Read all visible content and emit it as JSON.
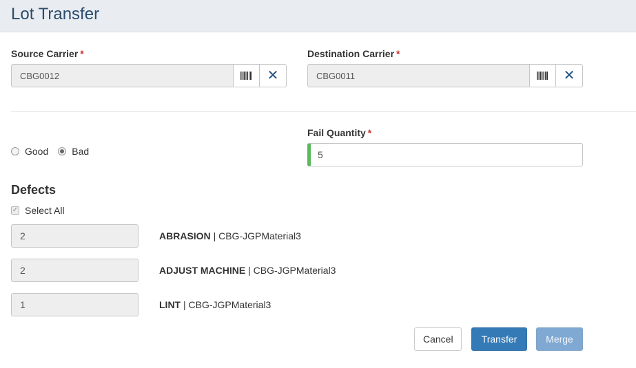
{
  "header": {
    "title": "Lot Transfer"
  },
  "source_carrier": {
    "label": "Source Carrier",
    "required_mark": "*",
    "value": "CBG0012",
    "scan_icon": "barcode-icon",
    "clear_icon": "close-icon"
  },
  "destination_carrier": {
    "label": "Destination Carrier",
    "required_mark": "*",
    "value": "CBG0011",
    "scan_icon": "barcode-icon",
    "clear_icon": "close-icon"
  },
  "quality": {
    "options": [
      {
        "label": "Good",
        "selected": false
      },
      {
        "label": "Bad",
        "selected": true
      }
    ]
  },
  "fail_quantity": {
    "label": "Fail Quantity",
    "required_mark": "*",
    "value": "5",
    "status_color": "#5cb85c"
  },
  "defects": {
    "title": "Defects",
    "select_all_label": "Select All",
    "select_all_checked": true,
    "separator": "|",
    "items": [
      {
        "quantity": "2",
        "name": "ABRASION",
        "material": "CBG-JGPMaterial3"
      },
      {
        "quantity": "2",
        "name": "ADJUST MACHINE",
        "material": "CBG-JGPMaterial3"
      },
      {
        "quantity": "1",
        "name": "LINT",
        "material": "CBG-JGPMaterial3"
      }
    ]
  },
  "actions": {
    "cancel_label": "Cancel",
    "transfer_label": "Transfer",
    "merge_label": "Merge"
  },
  "colors": {
    "primary": "#337ab7",
    "primary_disabled": "#7fa9d3",
    "required": "#c9302c",
    "header_bg": "#e9edf2",
    "title": "#2b4b6b",
    "icon": "#1f4f82"
  }
}
